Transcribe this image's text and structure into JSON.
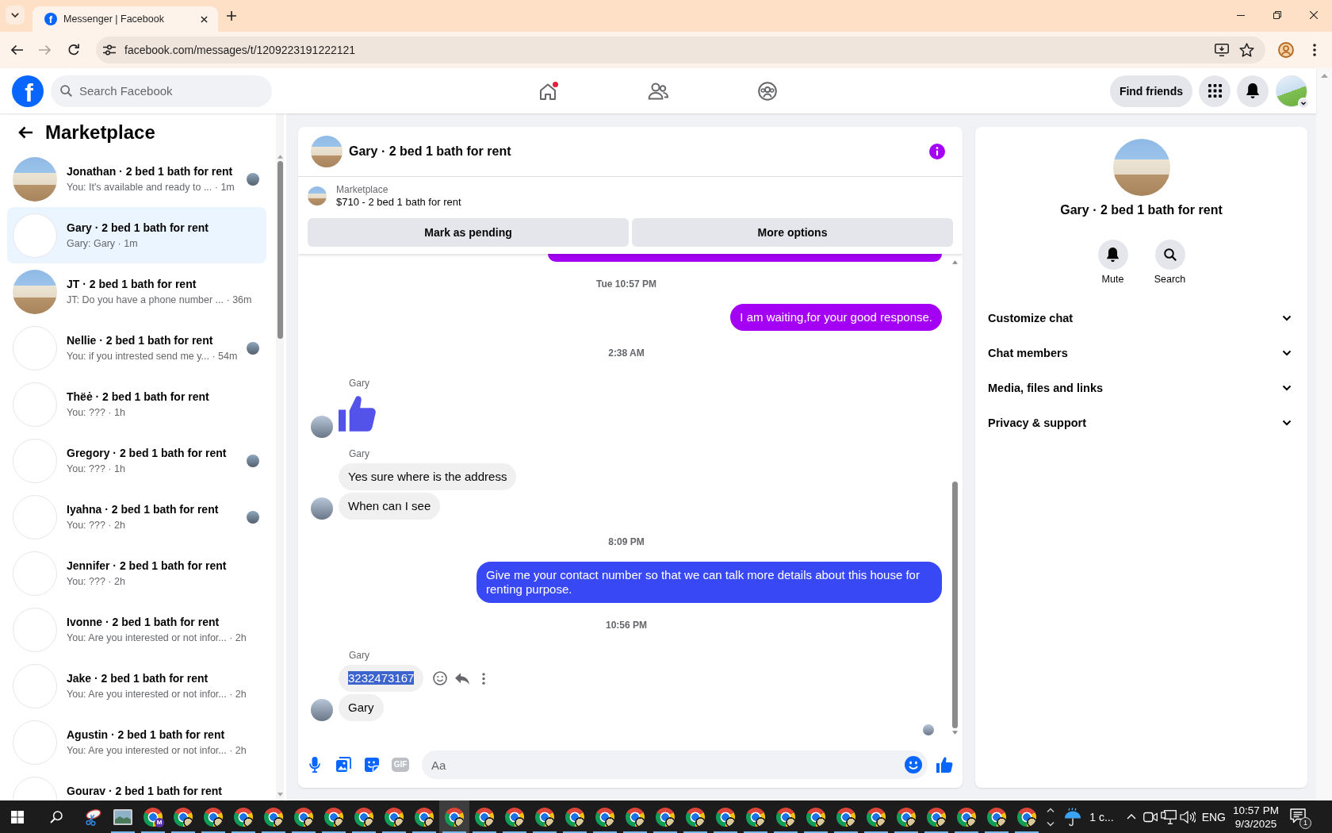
{
  "browser": {
    "tab": {
      "favicon": "f",
      "title": "Messenger | Facebook"
    },
    "nav_buttons": [
      {
        "kind": "back",
        "disabled": false
      },
      {
        "kind": "forward",
        "disabled": true
      },
      {
        "kind": "reload",
        "disabled": false
      }
    ],
    "url": "facebook.com/messages/t/1209223191222121"
  },
  "topbar": {
    "logo": "f",
    "search": {
      "placeholder": "Search Facebook"
    },
    "nav": [
      {
        "kind": "home",
        "dot": true
      },
      {
        "kind": "friends",
        "dot": false
      },
      {
        "kind": "groups",
        "dot": false
      }
    ],
    "find_friends": "Find friends"
  },
  "sidebar": {
    "title": "Marketplace",
    "conversations": [
      {
        "title": "Jonathan · 2 bed 1 bath for rent",
        "preview": "You: It's available and ready to ... · 1m",
        "photo": true,
        "seen": true,
        "selected": false
      },
      {
        "title": "Gary · 2 bed 1 bath for rent",
        "preview": "Gary: Gary · 1m",
        "photo": false,
        "seen": false,
        "selected": true
      },
      {
        "title": "JT · 2 bed 1 bath for rent",
        "preview": "JT: Do you have a phone number ... · 36m",
        "photo": true,
        "seen": false,
        "selected": false
      },
      {
        "title": "Nellie · 2 bed 1 bath for rent",
        "preview": "You: if you intrested send me y... · 54m",
        "photo": false,
        "seen": true,
        "selected": false
      },
      {
        "title": "Thëė · 2 bed 1 bath for rent",
        "preview": "You: ??? · 1h",
        "photo": false,
        "seen": false,
        "selected": false
      },
      {
        "title": "Gregory · 2 bed 1 bath for rent",
        "preview": "You: ??? · 1h",
        "photo": false,
        "seen": true,
        "selected": false
      },
      {
        "title": "Iyahna · 2 bed 1 bath for rent",
        "preview": "You: ??? · 2h",
        "photo": false,
        "seen": true,
        "selected": false
      },
      {
        "title": "Jennifer · 2 bed 1 bath for rent",
        "preview": "You: ??? · 2h",
        "photo": false,
        "seen": false,
        "selected": false
      },
      {
        "title": "Ivonne · 2 bed 1 bath for rent",
        "preview": "You: Are you interested or not infor... · 2h",
        "photo": false,
        "seen": false,
        "selected": false
      },
      {
        "title": "Jake · 2 bed 1 bath for rent",
        "preview": "You: Are you interested or not infor... · 2h",
        "photo": false,
        "seen": false,
        "selected": false
      },
      {
        "title": "Agustin · 2 bed 1 bath for rent",
        "preview": "You: Are you interested or not infor... · 2h",
        "photo": false,
        "seen": false,
        "selected": false
      },
      {
        "title": "Gourav · 2 bed 1 bath for rent",
        "photo": false,
        "seen": false,
        "selected": false
      }
    ]
  },
  "chat": {
    "title": "Gary · 2 bed 1 bath for rent",
    "listing": {
      "label": "Marketplace",
      "title": "$710 - 2 bed 1 bath for rent"
    },
    "actions": [
      "Mark as pending",
      "More options"
    ],
    "messages": [
      {
        "kind": "clipped",
        "color": "#a300f4"
      },
      {
        "kind": "time",
        "text": "Tue 10:57 PM"
      },
      {
        "kind": "outgoing",
        "text": "I am waiting,for your good response.",
        "color": "#a300f4"
      },
      {
        "kind": "time",
        "text": "2:38 AM"
      },
      {
        "kind": "incoming",
        "sender": "Gary",
        "bubbles": [
          {
            "kind": "like",
            "color": "#5353ea"
          }
        ]
      },
      {
        "kind": "incoming",
        "sender": "Gary",
        "bubbles": [
          {
            "kind": "text",
            "text": "Yes sure where is the address",
            "highlighted": false
          },
          {
            "kind": "text",
            "text": "When can I see",
            "highlighted": false
          }
        ]
      },
      {
        "kind": "time",
        "text": "8:09 PM"
      },
      {
        "kind": "outgoing",
        "text": "Give me your contact number so that we can talk more details about this house for renting purpose.",
        "color": "#3848f5"
      },
      {
        "kind": "time",
        "text": "10:56 PM"
      },
      {
        "kind": "incoming",
        "sender": "Gary",
        "bubbles": [
          {
            "kind": "text",
            "text": "3232473167",
            "highlighted": true,
            "actions": [
              {
                "kind": "react"
              },
              {
                "kind": "reply"
              },
              {
                "kind": "more"
              }
            ]
          },
          {
            "kind": "text",
            "text": "Gary",
            "highlighted": false
          }
        ]
      }
    ],
    "seen": true,
    "composer": {
      "tools": [
        {
          "kind": "mic"
        },
        {
          "kind": "photo"
        },
        {
          "kind": "sticker"
        },
        {
          "kind": "gif",
          "label": "GIF"
        }
      ],
      "placeholder": "Aa"
    }
  },
  "details": {
    "name": "Gary · 2 bed 1 bath for rent",
    "actions": [
      {
        "kind": "mute",
        "label": "Mute"
      },
      {
        "kind": "search",
        "label": "Search"
      }
    ],
    "sections": [
      {
        "label": "Customize chat",
        "expanded": false
      },
      {
        "label": "Chat members",
        "expanded": false
      },
      {
        "label": "Media, files and links",
        "expanded": false
      },
      {
        "label": "Privacy & support",
        "expanded": false
      }
    ]
  },
  "taskbar": {
    "apps": [
      {
        "kind": "scissors",
        "running": false,
        "selected": false
      },
      {
        "kind": "photos",
        "running": true,
        "selected": false
      },
      {
        "kind": "browser",
        "badge": "M",
        "running": true,
        "selected": false
      },
      {
        "kind": "browser",
        "running": true,
        "selected": false
      },
      {
        "kind": "browser",
        "running": true,
        "selected": false
      },
      {
        "kind": "browser",
        "running": true,
        "selected": false
      },
      {
        "kind": "browser",
        "running": true,
        "selected": false
      },
      {
        "kind": "browser",
        "running": true,
        "selected": false
      },
      {
        "kind": "browser",
        "running": true,
        "selected": false
      },
      {
        "kind": "browser",
        "running": true,
        "selected": false
      },
      {
        "kind": "browser",
        "running": true,
        "selected": false
      },
      {
        "kind": "browser",
        "running": true,
        "selected": false
      },
      {
        "kind": "browser",
        "running": true,
        "selected": true
      },
      {
        "kind": "browser",
        "running": true,
        "selected": false
      },
      {
        "kind": "browser",
        "running": true,
        "selected": false
      },
      {
        "kind": "browser",
        "running": true,
        "selected": false
      },
      {
        "kind": "browser",
        "running": true,
        "selected": false
      },
      {
        "kind": "browser",
        "running": true,
        "selected": false
      },
      {
        "kind": "browser",
        "running": true,
        "selected": false
      },
      {
        "kind": "browser",
        "running": true,
        "selected": false
      },
      {
        "kind": "browser",
        "running": true,
        "selected": false
      },
      {
        "kind": "browser",
        "running": true,
        "selected": false
      },
      {
        "kind": "browser",
        "running": true,
        "selected": false
      },
      {
        "kind": "browser",
        "running": true,
        "selected": false
      },
      {
        "kind": "browser",
        "running": true,
        "selected": false
      },
      {
        "kind": "browser",
        "running": true,
        "selected": false
      },
      {
        "kind": "browser",
        "running": true,
        "selected": false
      },
      {
        "kind": "browser",
        "running": true,
        "selected": false
      },
      {
        "kind": "browser",
        "running": true,
        "selected": false
      },
      {
        "kind": "browser",
        "running": true,
        "selected": false
      },
      {
        "kind": "browser",
        "running": true,
        "selected": false
      },
      {
        "kind": "browser",
        "running": true,
        "selected": false
      }
    ],
    "weather": "1 c...",
    "language": "ENG",
    "time": "10:57 PM",
    "date": "9/3/2025",
    "notifications": "1"
  }
}
